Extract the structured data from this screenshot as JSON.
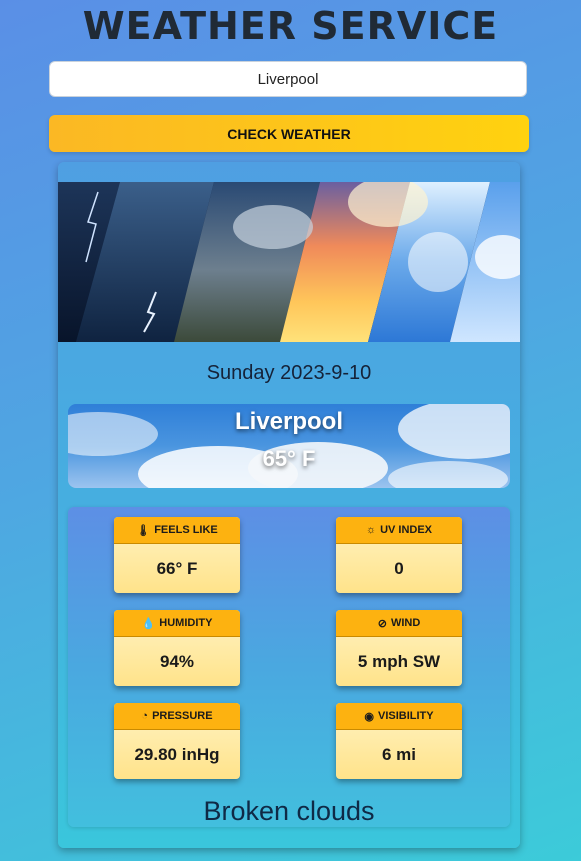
{
  "app": {
    "title": "WEATHER SERVICE"
  },
  "search": {
    "value": "Liverpool",
    "button_label": "CHECK WEATHER"
  },
  "forecast": {
    "date": "Sunday 2023-9-10",
    "city": "Liverpool",
    "temperature": "65° F",
    "description": "Broken clouds"
  },
  "metrics": [
    {
      "label": "FEELS LIKE",
      "value": "66° F",
      "icon": "thermometer-icon"
    },
    {
      "label": "UV INDEX",
      "value": "0",
      "icon": "sun-icon"
    },
    {
      "label": "HUMIDITY",
      "value": "94%",
      "icon": "droplet-icon"
    },
    {
      "label": "WIND",
      "value": "5 mph SW",
      "icon": "compass-icon"
    },
    {
      "label": "PRESSURE",
      "value": "29.80 inHg",
      "icon": "gauge-icon"
    },
    {
      "label": "VISIBILITY",
      "value": "6 mi",
      "icon": "eye-icon"
    }
  ],
  "colors": {
    "accent": "#fdb210",
    "button": "#ffd20f",
    "title": "#202a35"
  }
}
